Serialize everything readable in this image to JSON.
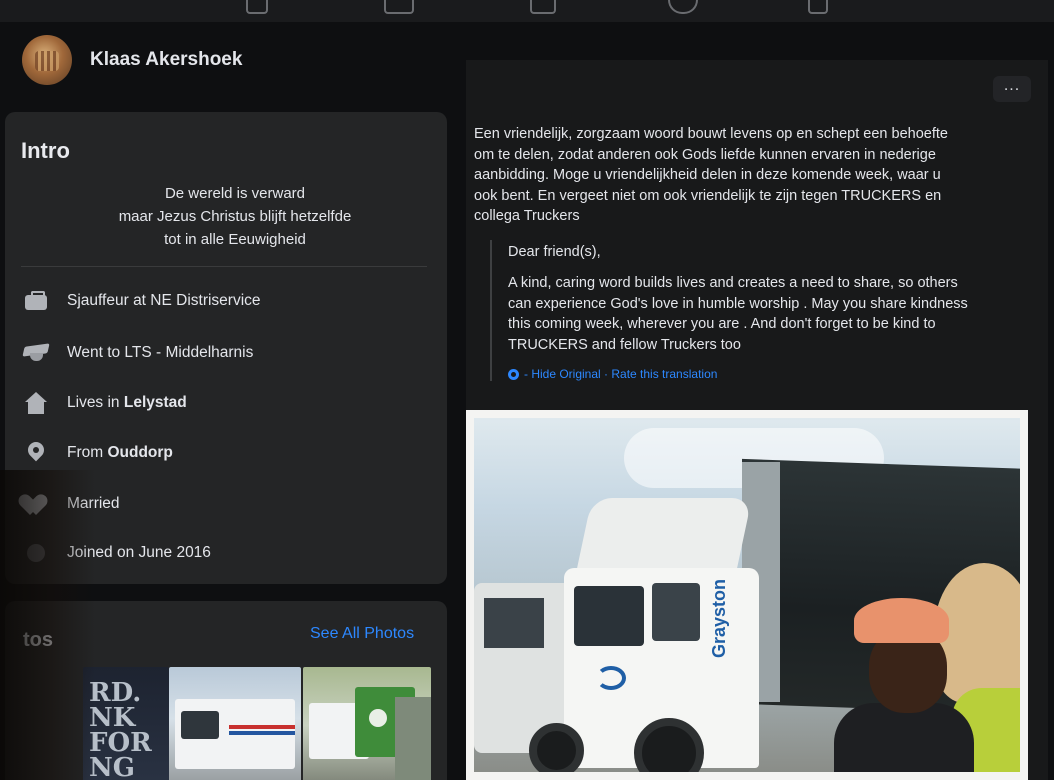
{
  "profile": {
    "name": "Klaas Akershoek"
  },
  "intro": {
    "title": "Intro",
    "bio_lines": [
      "De wereld is verward",
      "maar Jezus Christus blijft hetzelfde",
      "tot in alle Eeuwigheid"
    ],
    "work": "Sjauffeur at NE Distriservice",
    "education": "Went to LTS - Middelharnis",
    "lives_prefix": "Lives in ",
    "lives_place": "Lelystad",
    "from_prefix": "From ",
    "from_place": "Ouddorp",
    "relationship": "Married",
    "joined": "Joined on June 2016"
  },
  "photos": {
    "title": "tos",
    "see_all": "See All Photos",
    "thumb1_text": "RD.\nNK\nFOR\nNG\nUI"
  },
  "post": {
    "more_label": "...",
    "original_lines": [
      "Een vriendelijk, zorgzaam woord bouwt levens op en schept een behoefte",
      "om te delen, zodat anderen ook Gods liefde kunnen ervaren in nederige",
      "aanbidding. Moge u vriendelijkheid delen in deze komende week, waar u",
      "ook bent. En vergeet niet om ook vriendelijk te zijn tegen TRUCKERS en",
      "collega Truckers"
    ],
    "translation_greeting": "Dear friend(s),",
    "translation_lines": [
      "A kind, caring word builds lives and creates a need to share, so others",
      "can experience God's love in humble worship . May you share kindness",
      "this coming week, wherever you are . And don't forget to be kind to",
      "TRUCKERS and fellow Truckers too"
    ],
    "translation_links": "- Hide Original · Rate this translation",
    "photo_brand": "Grayston"
  },
  "icons": {
    "work": "briefcase-icon",
    "education": "graduation-cap-icon",
    "lives": "house-icon",
    "from": "location-pin-icon",
    "relationship": "heart-icon",
    "joined": "clock-icon",
    "translate": "gear-icon",
    "more": "more-options-icon"
  },
  "colors": {
    "background": "#0e0f11",
    "card": "#242526",
    "link": "#2d88ff",
    "text": "#e4e6eb"
  }
}
